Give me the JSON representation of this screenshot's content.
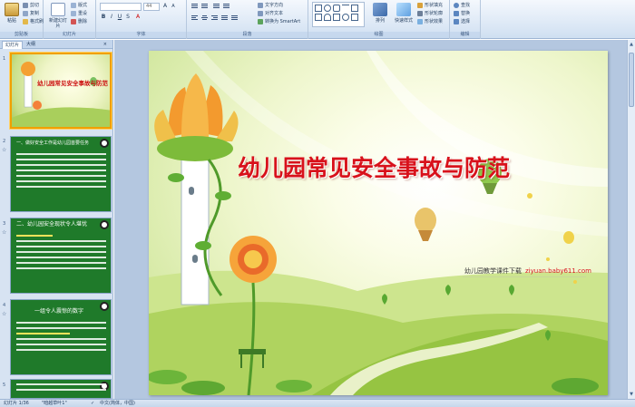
{
  "ribbon": {
    "clipboard": {
      "paste": "粘贴",
      "cut": "剪切",
      "copy": "复制",
      "format_painter": "格式刷",
      "label": "剪贴板"
    },
    "slides": {
      "new_slide": "新建幻灯片",
      "layout": "版式",
      "reset": "重设",
      "delete": "删除",
      "label": "幻灯片"
    },
    "font": {
      "size": "44",
      "buttons": [
        "B",
        "I",
        "U",
        "S",
        "A"
      ],
      "label": "字体"
    },
    "paragraph": {
      "text_direction": "文字方向",
      "align_text": "对齐文本",
      "smartart": "转换为 SmartArt",
      "label": "段落"
    },
    "drawing": {
      "arrange": "排列",
      "quick_styles": "快速样式",
      "shape_fill": "形状填充",
      "shape_outline": "形状轮廓",
      "shape_effects": "形状效果",
      "label": "绘图"
    },
    "editing": {
      "find": "查找",
      "replace": "替换",
      "select": "选择",
      "label": "编辑"
    }
  },
  "panel": {
    "tabs": [
      "幻灯片",
      "大纲"
    ],
    "close": "×"
  },
  "thumbnails": [
    {
      "num": "1",
      "title": "幼儿园常见安全事故与防范"
    },
    {
      "num": "2",
      "heading": "一、做好安全工作是幼儿园首要任务"
    },
    {
      "num": "3",
      "heading": "二、幼儿园安全现状令人堪忧"
    },
    {
      "num": "4",
      "heading": "一组令人震惊的数字"
    },
    {
      "num": "5",
      "heading": ""
    }
  ],
  "slide": {
    "title": "幼儿园常见安全事故与防范",
    "watermark_text": "幼儿园教学课件下载",
    "watermark_url": "ziyuan.baby611.com"
  },
  "status": {
    "slide_info": "幻灯片 1/36",
    "theme": "\"暗越草叶1\"",
    "language": "中文(简体，中国)"
  },
  "colors": {
    "title_red": "#d8111b",
    "ribbon_blue": "#dbe7f5",
    "thumb_green": "#1f7a2a",
    "selected_border": "#f0a000"
  }
}
